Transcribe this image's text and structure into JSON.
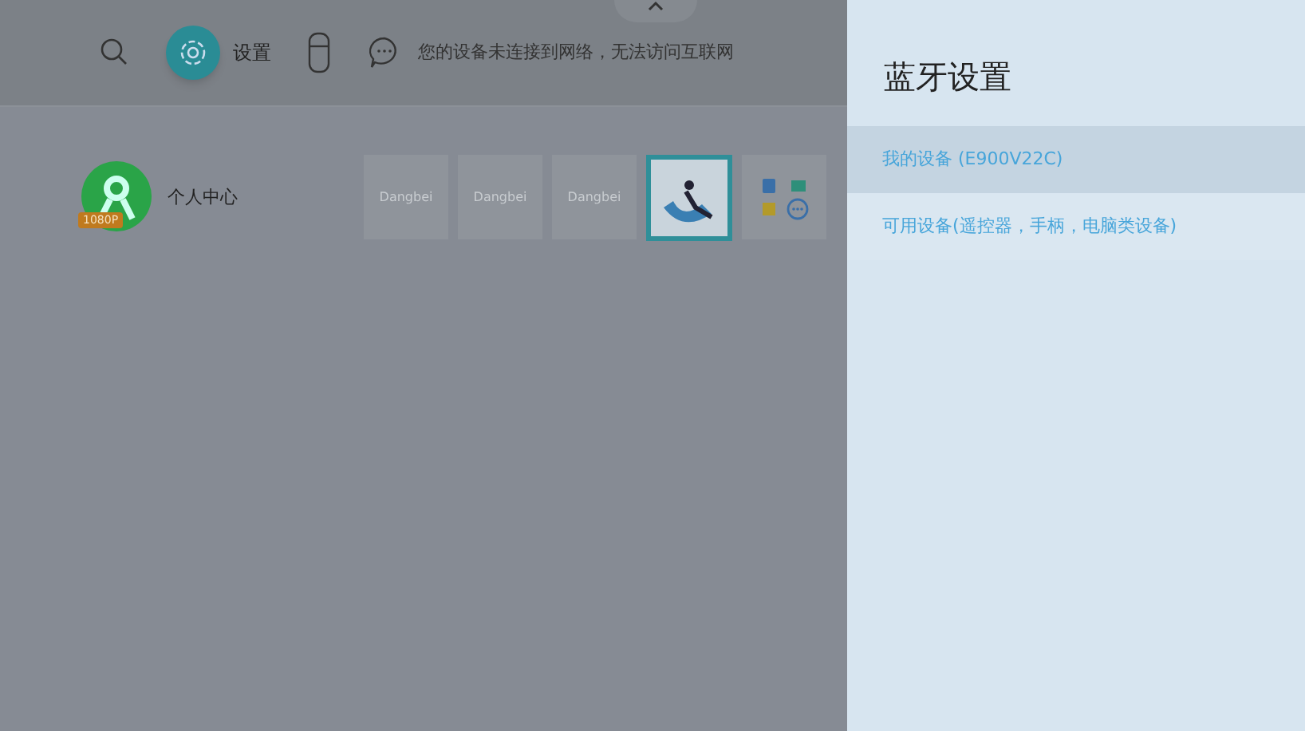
{
  "top_bar": {
    "items": [
      {
        "kind": "search",
        "selected": false
      },
      {
        "kind": "settings",
        "label": "设置",
        "selected": true
      },
      {
        "kind": "usb",
        "selected": false
      },
      {
        "kind": "message",
        "label": "您的设备未连接到网络，无法访问互联网",
        "selected": false
      }
    ]
  },
  "home": {
    "profile": {
      "label": "个人中心",
      "badge": "1080P"
    },
    "tiles": [
      {
        "kind": "placeholder",
        "label": "Dangbei"
      },
      {
        "kind": "placeholder",
        "label": "Dangbei"
      },
      {
        "kind": "placeholder",
        "label": "Dangbei"
      },
      {
        "kind": "artwork"
      },
      {
        "kind": "apps"
      }
    ]
  },
  "panel": {
    "title": "蓝牙设置",
    "items": [
      {
        "label": "我的设备 (E900V22C)",
        "selected": true
      },
      {
        "label": "可用设备(遥控器，手柄，电脑类设备)",
        "selected": false
      }
    ]
  }
}
